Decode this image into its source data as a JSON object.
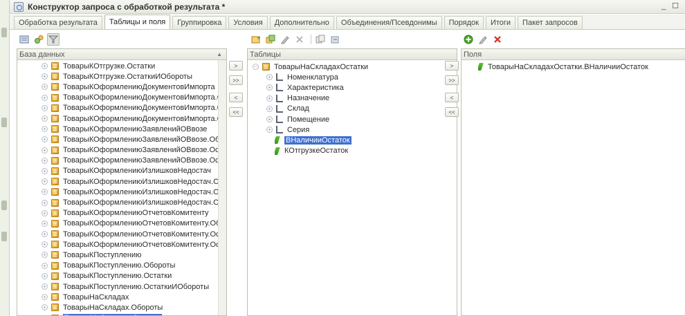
{
  "window": {
    "title": "Конструктор запроса с обработкой результата *",
    "controls": "_ ☐"
  },
  "tabs": [
    {
      "label": "Обработка результата"
    },
    {
      "label": "Таблицы и поля"
    },
    {
      "label": "Группировка"
    },
    {
      "label": "Условия"
    },
    {
      "label": "Дополнительно"
    },
    {
      "label": "Объединения/Псевдонимы"
    },
    {
      "label": "Порядок"
    },
    {
      "label": "Итоги"
    },
    {
      "label": "Пакет запросов"
    }
  ],
  "database_panel": {
    "header": "База данных",
    "items": [
      {
        "label": "ТоварыКОтгрузке.Остатки"
      },
      {
        "label": "ТоварыКОтгрузке.ОстаткиИОбороты"
      },
      {
        "label": "ТоварыКОформлениюДокументовИмпорта"
      },
      {
        "label": "ТоварыКОформлениюДокументовИмпорта.Обороты"
      },
      {
        "label": "ТоварыКОформлениюДокументовИмпорта.Остатки"
      },
      {
        "label": "ТоварыКОформлениюДокументовИмпорта.ОстаткиИ"
      },
      {
        "label": "ТоварыКОформлениюЗаявленийОВвозе"
      },
      {
        "label": "ТоварыКОформлениюЗаявленийОВвозе.Обороты"
      },
      {
        "label": "ТоварыКОформлениюЗаявленийОВвозе.Остатки"
      },
      {
        "label": "ТоварыКОформлениюЗаявленийОВвозе.ОстаткиИО"
      },
      {
        "label": "ТоварыКОформлениюИзлишковНедостач"
      },
      {
        "label": "ТоварыКОформлениюИзлишковНедостач.Обороты"
      },
      {
        "label": "ТоварыКОформлениюИзлишковНедостач.Остатки"
      },
      {
        "label": "ТоварыКОформлениюИзлишковНедостач.ОстаткиИ"
      },
      {
        "label": "ТоварыКОформлениюОтчетовКомитенту"
      },
      {
        "label": "ТоварыКОформлениюОтчетовКомитенту.Обороты"
      },
      {
        "label": "ТоварыКОформлениюОтчетовКомитенту.Остатки"
      },
      {
        "label": "ТоварыКОформлениюОтчетовКомитенту.ОстаткиИС"
      },
      {
        "label": "ТоварыКПоступлению"
      },
      {
        "label": "ТоварыКПоступлению.Обороты"
      },
      {
        "label": "ТоварыКПоступлению.Остатки"
      },
      {
        "label": "ТоварыКПоступлению.ОстаткиИОбороты"
      },
      {
        "label": "ТоварыНаСкладах"
      },
      {
        "label": "ТоварыНаСкладах.Обороты"
      },
      {
        "label": "ТоварыНаСкладах.Остатки"
      }
    ]
  },
  "tables_panel": {
    "header": "Таблицы",
    "root": "ТоварыНаСкладахОстатки",
    "dimensions": [
      "Номенклатура",
      "Характеристика",
      "Назначение",
      "Склад",
      "Помещение",
      "Серия"
    ],
    "resources": [
      "ВНаличииОстаток",
      "КОтгрузкеОстаток"
    ]
  },
  "fields_panel": {
    "header": "Поля",
    "items": [
      "ТоварыНаСкладахОстатки.ВНаличииОстаток"
    ]
  },
  "move_buttons": {
    "add": ">",
    "add_all": ">>",
    "remove": "<",
    "remove_all": "<<"
  },
  "colors": {
    "selection": "#3d6fcf",
    "accent_green": "#3c8f1c",
    "accent_red": "#d43a2a"
  },
  "icons": {
    "toolbar1": [
      "open-query-icon",
      "settings-gears-icon",
      "filter-icon"
    ],
    "toolbar2": [
      "add-table-icon",
      "add-nested-query-icon",
      "edit-pencil-icon",
      "delete-x-icon",
      "copy-table-icon",
      "replace-table-icon"
    ],
    "toolbar3": [
      "add-green-plus-icon",
      "edit-pencil-icon",
      "delete-red-x-icon"
    ]
  }
}
